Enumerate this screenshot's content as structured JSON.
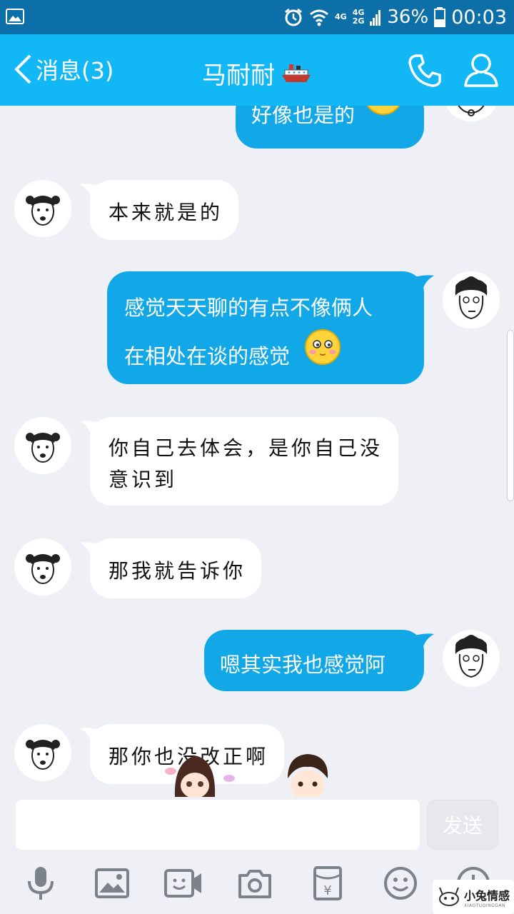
{
  "status_bar": {
    "network_top": "4G",
    "network_2": "4G",
    "network_3": "2G",
    "battery": "36%",
    "time": "00:03"
  },
  "header": {
    "back_label": "消息(3)",
    "title": "马耐耐",
    "title_emoji": "ship-icon"
  },
  "messages": [
    {
      "side": "out",
      "text": "好像也是的",
      "emoji": "smile-emoji"
    },
    {
      "side": "in",
      "text": "本来就是的"
    },
    {
      "side": "out",
      "lines": [
        "感觉天天聊的有点不像俩人",
        "在相处在谈的感觉"
      ],
      "emoji": "shy-emoji"
    },
    {
      "side": "in",
      "lines": [
        "你自己去体会，是你自己没",
        "意识到"
      ]
    },
    {
      "side": "in",
      "text": "那我就告诉你"
    },
    {
      "side": "out",
      "text": "嗯其实我也感觉阿"
    },
    {
      "side": "in",
      "text": "那你也没改正啊"
    }
  ],
  "composer": {
    "placeholder": "",
    "send_label": "发送"
  },
  "toolbar": [
    "microphone-icon",
    "image-icon",
    "video-icon",
    "camera-icon",
    "red-packet-icon",
    "emoji-icon",
    "more-icon"
  ],
  "watermark": {
    "text": "小兔情感",
    "sub": "XIAOTUQINGGAN"
  },
  "colors": {
    "status_bar": "#0d6fa8",
    "nav_bar": "#12b7f5",
    "outgoing_bubble": "#12a8e8",
    "incoming_bubble": "#ffffff",
    "background": "#eef0f5"
  }
}
